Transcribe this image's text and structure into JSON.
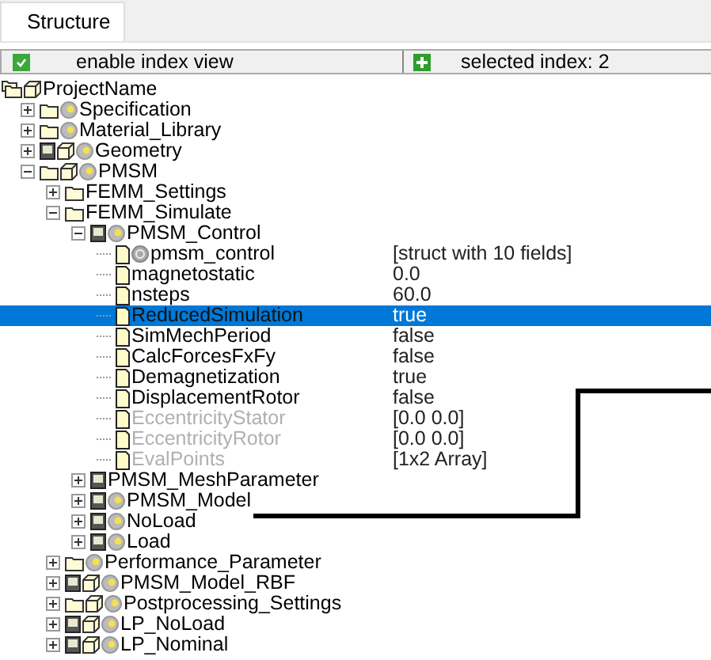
{
  "tab": {
    "label": "Structure"
  },
  "header": {
    "index_view": {
      "label": "enable index view",
      "checked": true
    },
    "selected_index": {
      "label": "selected index: 2"
    }
  },
  "tree": [
    {
      "label": "ProjectName",
      "kind": "project",
      "selected": false,
      "disabled": false,
      "children": [
        {
          "label": "Specification",
          "kind": "group",
          "expanded": false,
          "selected": false,
          "disabled": false
        },
        {
          "label": "Material_Library",
          "kind": "group",
          "expanded": false,
          "selected": false,
          "disabled": false
        },
        {
          "label": "Geometry",
          "kind": "model",
          "expanded": false,
          "selected": false,
          "disabled": false
        },
        {
          "label": "PMSM",
          "kind": "assembly",
          "expanded": true,
          "selected": false,
          "disabled": false,
          "children": [
            {
              "label": "FEMM_Settings",
              "kind": "folder",
              "expanded": false,
              "selected": false,
              "disabled": false
            },
            {
              "label": "FEMM_Simulate",
              "kind": "folder",
              "expanded": true,
              "selected": false,
              "disabled": false,
              "children": [
                {
                  "label": "PMSM_Control",
                  "kind": "block",
                  "expanded": true,
                  "selected": false,
                  "disabled": false,
                  "children": [
                    {
                      "label": "pmsm_control",
                      "value": "[struct with 10 fields]",
                      "kind": "record",
                      "selected": false,
                      "disabled": false
                    },
                    {
                      "label": "magnetostatic",
                      "value": "0.0",
                      "kind": "field",
                      "selected": false,
                      "disabled": false
                    },
                    {
                      "label": "nsteps",
                      "value": "60.0",
                      "kind": "field",
                      "selected": false,
                      "disabled": false
                    },
                    {
                      "label": "ReducedSimulation",
                      "value": "true",
                      "kind": "field",
                      "selected": true,
                      "disabled": false
                    },
                    {
                      "label": "SimMechPeriod",
                      "value": "false",
                      "kind": "field",
                      "selected": false,
                      "disabled": false
                    },
                    {
                      "label": "CalcForcesFxFy",
                      "value": "false",
                      "kind": "field",
                      "selected": false,
                      "disabled": false
                    },
                    {
                      "label": "Demagnetization",
                      "value": "true",
                      "kind": "field",
                      "selected": false,
                      "disabled": false
                    },
                    {
                      "label": "DisplacementRotor",
                      "value": "false",
                      "kind": "field",
                      "selected": false,
                      "disabled": false
                    },
                    {
                      "label": "EccentricityStator",
                      "value": "[0.0 0.0]",
                      "kind": "field",
                      "selected": false,
                      "disabled": true
                    },
                    {
                      "label": "EccentricityRotor",
                      "value": "[0.0 0.0]",
                      "kind": "field",
                      "selected": false,
                      "disabled": true
                    },
                    {
                      "label": "EvalPoints",
                      "value": "[1x2 Array]",
                      "kind": "field",
                      "selected": false,
                      "disabled": true
                    }
                  ]
                },
                {
                  "label": "PMSM_MeshParameter",
                  "kind": "mesh",
                  "expanded": false,
                  "selected": false,
                  "disabled": false
                },
                {
                  "label": "PMSM_Model",
                  "kind": "block",
                  "expanded": false,
                  "selected": false,
                  "disabled": false
                },
                {
                  "label": "NoLoad",
                  "kind": "block",
                  "expanded": false,
                  "selected": false,
                  "disabled": false
                },
                {
                  "label": "Load",
                  "kind": "block",
                  "expanded": false,
                  "selected": false,
                  "disabled": false
                }
              ]
            },
            {
              "label": "Performance_Parameter",
              "kind": "group",
              "expanded": false,
              "selected": false,
              "disabled": false
            },
            {
              "label": "PMSM_Model_RBF",
              "kind": "model",
              "expanded": false,
              "selected": false,
              "disabled": false
            },
            {
              "label": "Postprocessing_Settings",
              "kind": "assembly",
              "expanded": false,
              "selected": false,
              "disabled": false
            },
            {
              "label": "LP_NoLoad",
              "kind": "model",
              "expanded": false,
              "selected": false,
              "disabled": false
            },
            {
              "label": "LP_Nominal",
              "kind": "model",
              "expanded": false,
              "selected": false,
              "disabled": false
            }
          ]
        }
      ]
    }
  ]
}
